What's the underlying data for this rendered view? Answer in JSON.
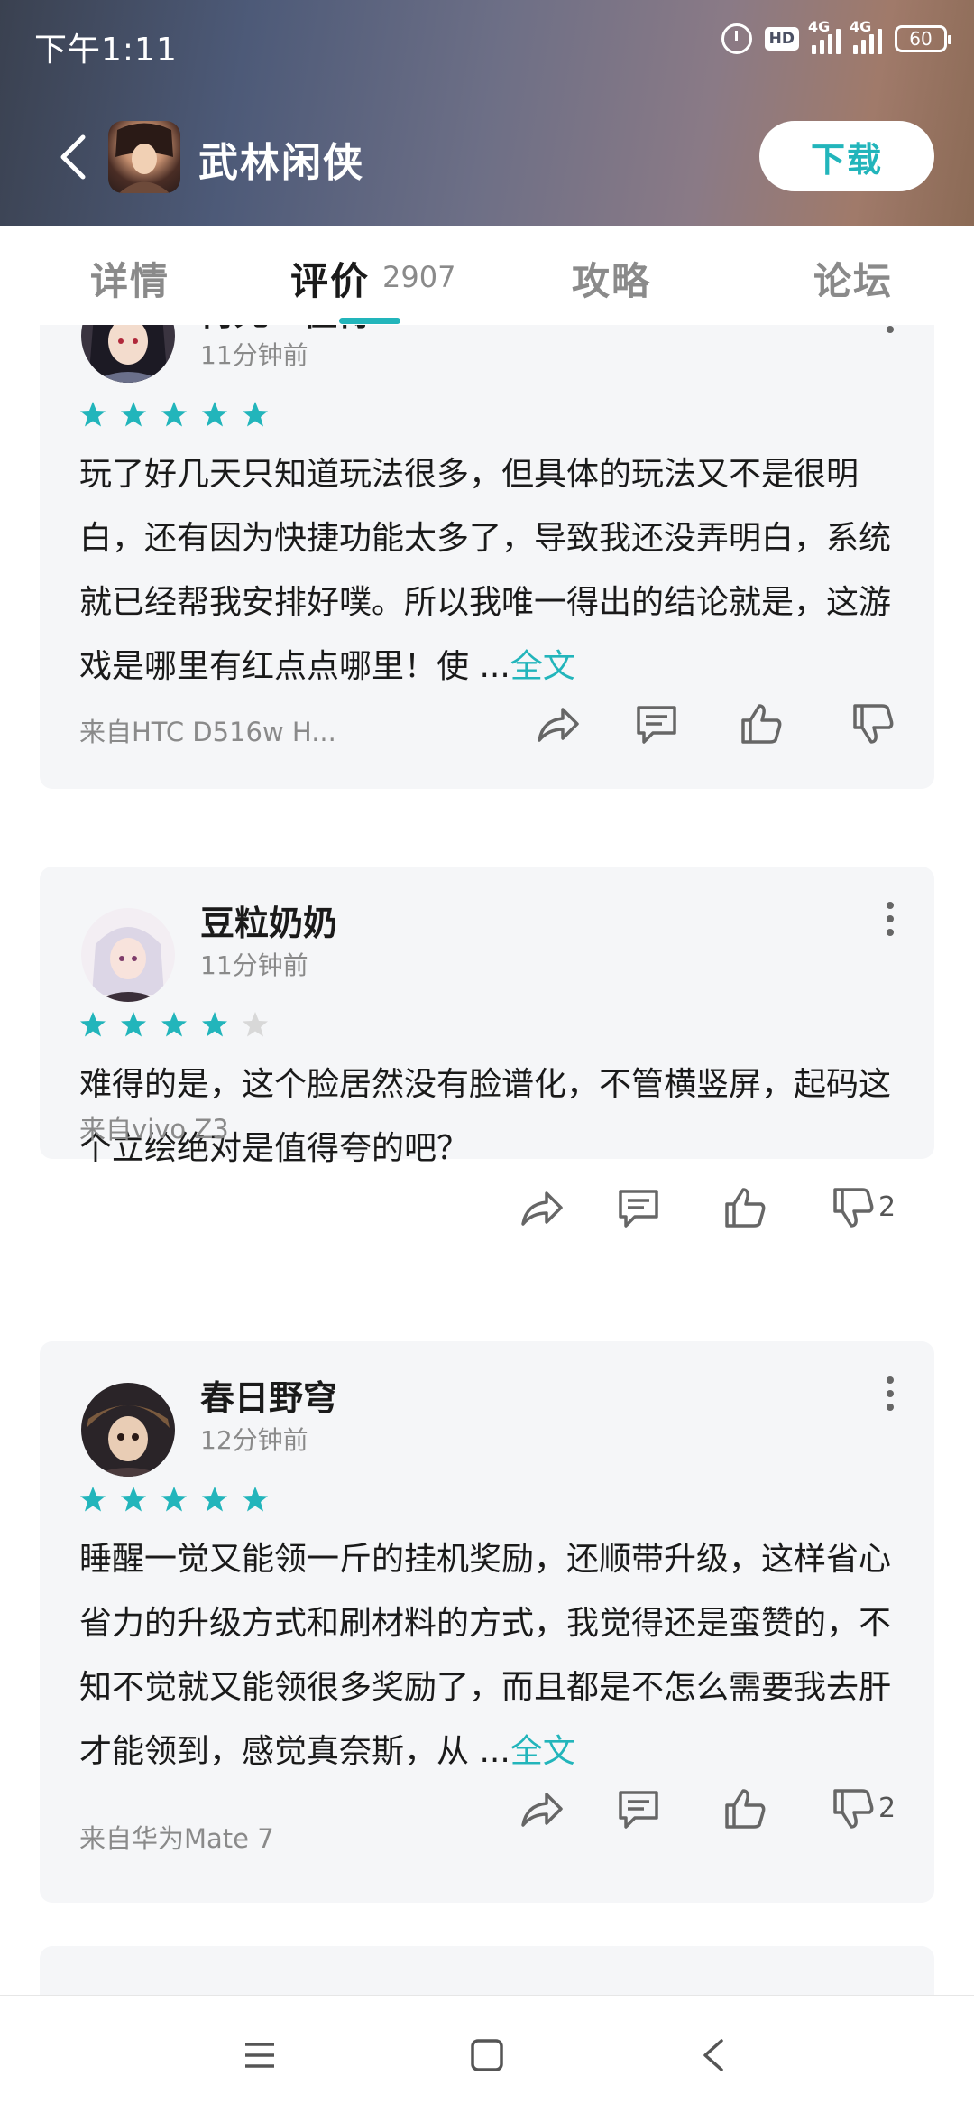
{
  "status_bar": {
    "time": "下午1:11",
    "hd": "HD",
    "net1": "4G",
    "net2": "4G",
    "battery": "60"
  },
  "header": {
    "app_title": "武林闲侠",
    "download_label": "下载"
  },
  "tabs": [
    {
      "label": "详情"
    },
    {
      "label": "评价",
      "count": "2907"
    },
    {
      "label": "攻略"
    },
    {
      "label": "论坛"
    }
  ],
  "reviews": [
    {
      "username": "再死一值得",
      "time": "11分钟前",
      "rating": 5,
      "text": "玩了好几天只知道玩法很多，但具体的玩法又不是很明白，还有因为快捷功能太多了，导致我还没弄明白，系统就已经帮我安排好噗。所以我唯一得出的结论就是，这游戏是哪里有红点点哪里！使 ...",
      "full_text_label": "全文",
      "device": "来自HTC D516w H...",
      "dislike_count": ""
    },
    {
      "username": "豆粒奶奶",
      "time": "11分钟前",
      "rating": 4,
      "text": "难得的是，这个脸居然没有脸谱化，不管横竖屏，起码这个立绘绝对是值得夸的吧？",
      "full_text_label": "",
      "device": "来自vivo Z3",
      "dislike_count": "2"
    },
    {
      "username": "春日野穹",
      "time": "12分钟前",
      "rating": 5,
      "text": "睡醒一觉又能领一斤的挂机奖励，还顺带升级，这样省心省力的升级方式和刷材料的方式，我觉得还是蛮赞的，不知不觉就又能领很多奖励了，而且都是不怎么需要我去肝才能领到，感觉真奈斯，从 ...",
      "full_text_label": "全文",
      "device": "来自华为Mate 7",
      "dislike_count": "2"
    }
  ],
  "colors": {
    "accent": "#22b5bb",
    "star_empty": "#d8d8d8"
  }
}
